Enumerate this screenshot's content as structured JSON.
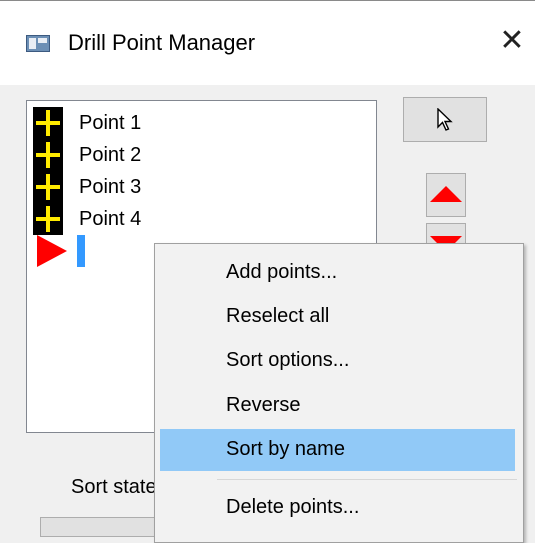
{
  "window": {
    "title": "Drill Point Manager",
    "close_glyph": "✕",
    "icon": "app-window-icon"
  },
  "points_list": {
    "items": [
      {
        "label": "Point 1",
        "icon": "drill-point-icon"
      },
      {
        "label": "Point 2",
        "icon": "drill-point-icon"
      },
      {
        "label": "Point 3",
        "icon": "drill-point-icon"
      },
      {
        "label": "Point 4",
        "icon": "drill-point-icon"
      }
    ],
    "insert_marker_icon": "insert-arrow-icon"
  },
  "side_buttons": {
    "pick_icon": "cursor-icon",
    "move_up_icon": "up-arrow-icon",
    "move_down_icon": "down-arrow-icon"
  },
  "sort_state": {
    "label": "Sort state"
  },
  "context_menu": {
    "items": [
      {
        "label": "Add points...",
        "highlighted": false
      },
      {
        "label": "Reselect all",
        "highlighted": false
      },
      {
        "label": "Sort options...",
        "highlighted": false
      },
      {
        "label": "Reverse",
        "highlighted": false
      },
      {
        "label": "Sort by name",
        "highlighted": true
      },
      {
        "label": "Delete points...",
        "highlighted": false
      }
    ]
  },
  "colors": {
    "point_icon_bg": "#000000",
    "point_icon_cross": "#ffeb00",
    "arrows": "#ff0000",
    "caret": "#3399ff",
    "menu_highlight": "#91c9f7"
  }
}
